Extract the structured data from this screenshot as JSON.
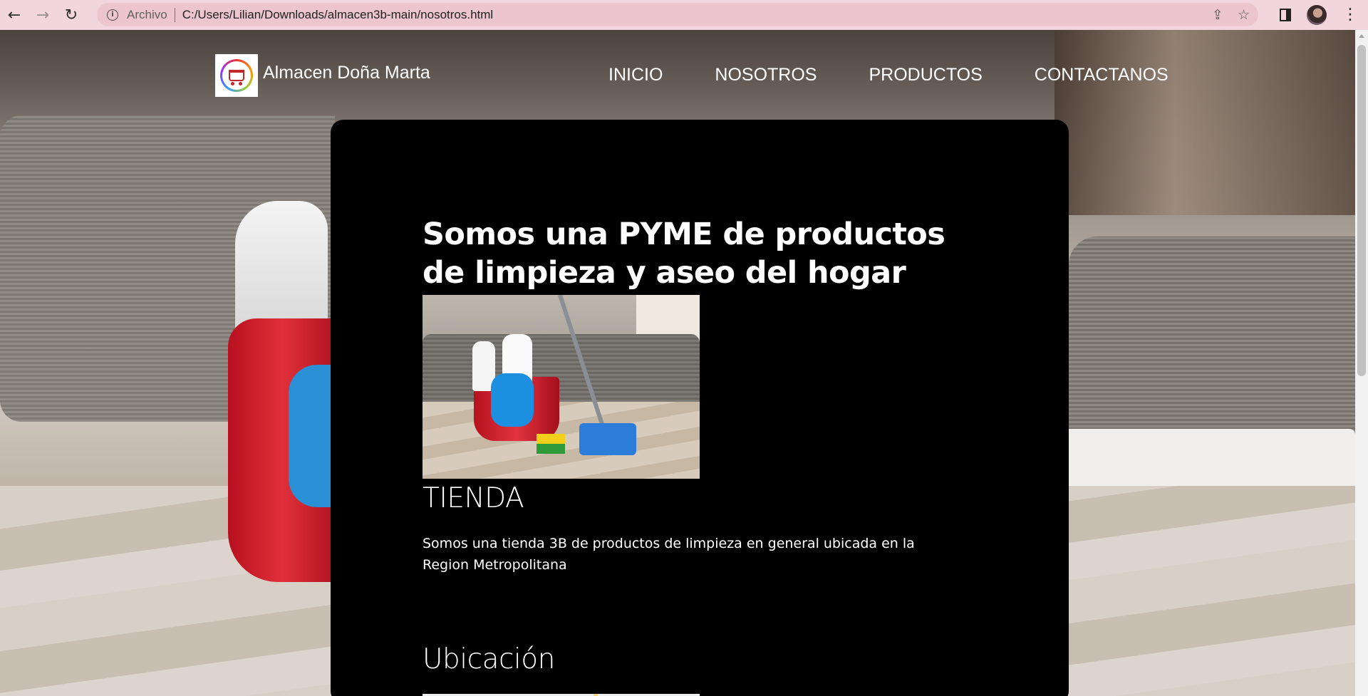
{
  "browser": {
    "back_icon": "arrow-left-icon",
    "forward_icon": "arrow-right-icon",
    "reload_icon": "reload-icon",
    "scheme_label": "Archivo",
    "url": "C:/Users/Lilian/Downloads/almacen3b-main/nosotros.html",
    "share_icon": "share-icon",
    "star_icon": "star-icon",
    "panel_icon": "side-panel-icon",
    "menu_icon": "kebab-menu-icon"
  },
  "site": {
    "brand": "Almacen Doña Marta",
    "nav": [
      {
        "label": "INICIO"
      },
      {
        "label": "NOSOTROS"
      },
      {
        "label": "PRODUCTOS"
      },
      {
        "label": "CONTACTANOS"
      }
    ]
  },
  "main": {
    "headline": "Somos una PYME de productos de limpieza y aseo del hogar",
    "store_title": "TIENDA",
    "store_description": "Somos una tienda 3B de productos de limpieza en general ubicada en la Region Metropolitana",
    "location_title": "Ubicación"
  },
  "colors": {
    "chrome_bg": "#f2d6dd",
    "omnibox_bg": "#ecc5cf",
    "card_bg": "#000000",
    "text": "#ffffff"
  }
}
